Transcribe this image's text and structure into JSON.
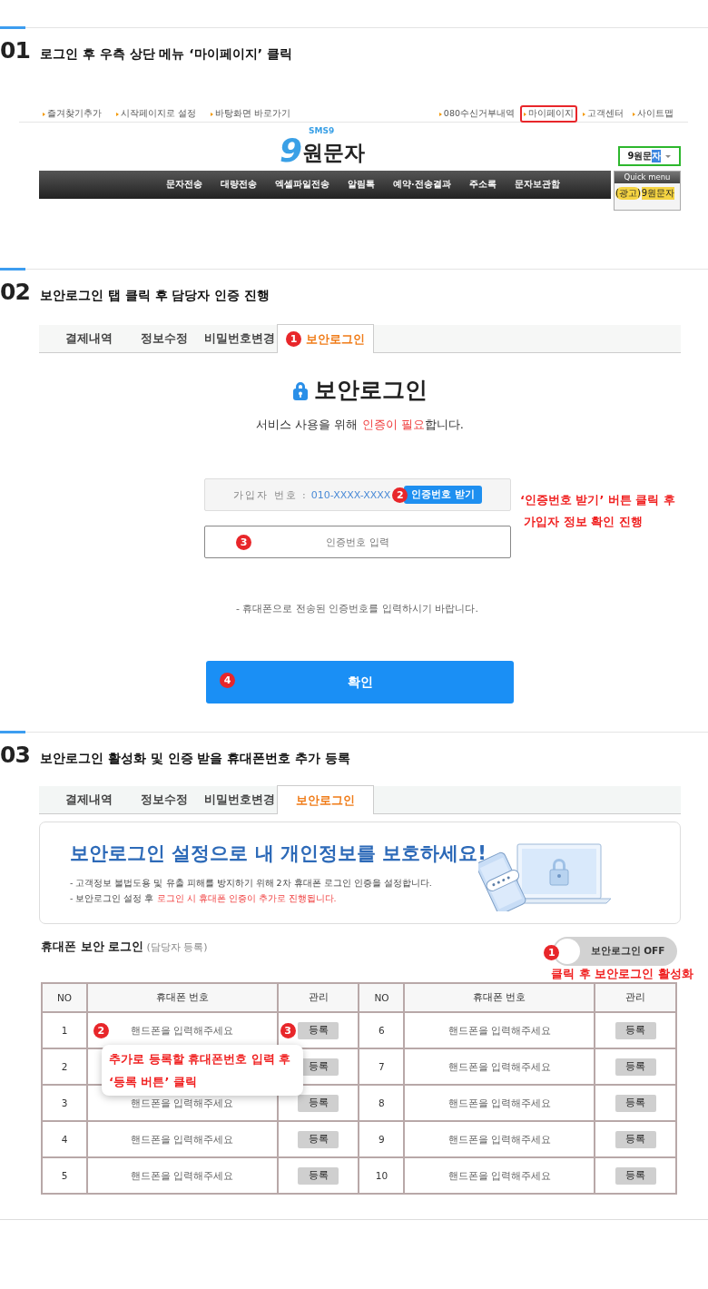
{
  "step1": {
    "number": "01",
    "title": "로그인 후 우측 상단 메뉴 ‘마이페이지’ 클릭",
    "site": {
      "top_links_left": [
        "즐겨찾기추가",
        "시작페이지로 설정",
        "바탕화면 바로가기"
      ],
      "top_links_right": [
        {
          "label": "080수신거부내역",
          "highlighted": false
        },
        {
          "label": "마이페이지",
          "highlighted": true
        },
        {
          "label": "고객센터",
          "highlighted": false
        },
        {
          "label": "사이트맵",
          "highlighted": false
        }
      ],
      "logo": {
        "tagline": "SMS9",
        "digit": "9",
        "name": "원문자"
      },
      "nav": [
        "문자전송",
        "대량전송",
        "엑셀파일전송",
        "알림톡",
        "예약·전송결과",
        "주소록",
        "문자보관함"
      ],
      "search": {
        "value": "9원문",
        "selection": "자"
      },
      "quick_menu": {
        "title": "Quick menu",
        "ad_label": "(광고)",
        "ad_text": "9원문자"
      }
    }
  },
  "step2": {
    "number": "02",
    "title": "보안로그인 탭 클릭 후 담당자 인증 진행",
    "tabs": [
      {
        "label": "결제내역",
        "selected": false
      },
      {
        "label": "정보수정",
        "selected": false
      },
      {
        "label": "비밀번호변경",
        "selected": false
      },
      {
        "label": "보안로그인",
        "selected": true,
        "marker": "1"
      }
    ],
    "heading": "보안로그인",
    "subtitle": [
      {
        "text": "서비스 사용을 위해 ",
        "emphasis": false
      },
      {
        "text": "인증이 필요",
        "emphasis": true
      },
      {
        "text": "합니다.",
        "emphasis": false
      }
    ],
    "member_field": {
      "label": "가입자 번호 :",
      "value": "010-XXXX-XXXX",
      "marker": "2",
      "button": "인증번호 받기"
    },
    "code_field": {
      "placeholder": "인증번호 입력",
      "marker": "3"
    },
    "note": "- 휴대폰으로 전송된 인증번호를 입력하시기 바랍니다.",
    "confirm": {
      "label": "확인",
      "marker": "4"
    },
    "callout": [
      "‘인증번호 받기’ 버튼 클릭 후",
      "가입자 정보 확인 진행"
    ]
  },
  "step3": {
    "number": "03",
    "title": "보안로그인 활성화 및 인증 받을 휴대폰번호 추가 등록",
    "tabs": [
      {
        "label": "결제내역",
        "selected": false
      },
      {
        "label": "정보수정",
        "selected": false
      },
      {
        "label": "비밀번호변경",
        "selected": false
      },
      {
        "label": "보안로그인",
        "selected": true
      }
    ],
    "banner": {
      "headline": "보안로그인 설정으로 내 개인정보를 보호하세요!",
      "lines": [
        [
          {
            "text": "- 고객정보 불법도용 및 유출 피해를 방지하기 위해 2차 휴대폰 로그인 인증을 설정합니다.",
            "emphasis": false
          }
        ],
        [
          {
            "text": "- 보안로그인 설정 후 ",
            "emphasis": false
          },
          {
            "text": "로그인 시 휴대폰 인증이 추가로 진행됩니다.",
            "emphasis": true
          }
        ]
      ]
    },
    "section_title": "휴대폰 보안 로그인",
    "section_note": "(담당자 등록)",
    "toggle": {
      "label": "보안로그인 OFF",
      "on": false,
      "marker": "1"
    },
    "toggle_callout": "클릭 후 보안로그인 활성화",
    "table": {
      "columns": [
        "NO",
        "휴대폰 번호",
        "관리",
        "NO",
        "휴대폰 번호",
        "관리"
      ],
      "rows": [
        [
          {
            "no": "1",
            "placeholder": "핸드폰을 입력해주세요",
            "button": "등록",
            "phone_marker": "2",
            "button_marker": "3"
          },
          {
            "no": "6",
            "placeholder": "핸드폰을 입력해주세요",
            "button": "등록"
          }
        ],
        [
          {
            "no": "2",
            "button": "등록"
          },
          {
            "no": "7",
            "placeholder": "핸드폰을 입력해주세요",
            "button": "등록"
          }
        ],
        [
          {
            "no": "3",
            "placeholder": "핸드폰을 입력해주세요",
            "button": "등록"
          },
          {
            "no": "8",
            "placeholder": "핸드폰을 입력해주세요",
            "button": "등록"
          }
        ],
        [
          {
            "no": "4",
            "placeholder": "핸드폰을 입력해주세요",
            "button": "등록"
          },
          {
            "no": "9",
            "placeholder": "핸드폰을 입력해주세요",
            "button": "등록"
          }
        ],
        [
          {
            "no": "5",
            "placeholder": "핸드폰을 입력해주세요",
            "button": "등록"
          },
          {
            "no": "10",
            "placeholder": "핸드폰을 입력해주세요",
            "button": "등록"
          }
        ]
      ]
    },
    "tooltip": [
      "추가로 등록할 휴대폰번호 입력 후",
      "‘등록 버튼’ 클릭"
    ]
  }
}
